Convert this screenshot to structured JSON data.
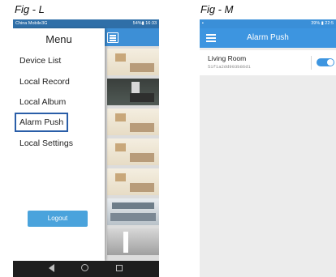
{
  "figures": {
    "left_caption": "Fig - L",
    "right_caption": "Fig - M"
  },
  "phone_l": {
    "status_bar": {
      "carrier": "China Mobile3G",
      "right_text": "54%▮ 16:33"
    },
    "drawer": {
      "title": "Menu",
      "items": [
        {
          "label": "Device List"
        },
        {
          "label": "Local Record"
        },
        {
          "label": "Local Album"
        },
        {
          "label": "Alarm Push",
          "highlighted": true
        },
        {
          "label": "Local Settings"
        }
      ],
      "logout_label": "Logout"
    },
    "background_header_icon": "menu-icon",
    "nav_icons": [
      "back-icon",
      "home-icon",
      "recent-apps-icon"
    ]
  },
  "phone_m": {
    "status_bar": {
      "right_text": "39% ▮ 22:5"
    },
    "header": {
      "title": "Alarm Push",
      "menu_icon": "hamburger-icon"
    },
    "device": {
      "name": "Living Room",
      "id": "51f1a2dd903b86d1",
      "alarm_enabled": true
    }
  },
  "colors": {
    "accent": "#3d95e0",
    "highlight_border": "#2a5ea8",
    "logout_button": "#4aa3dc"
  }
}
